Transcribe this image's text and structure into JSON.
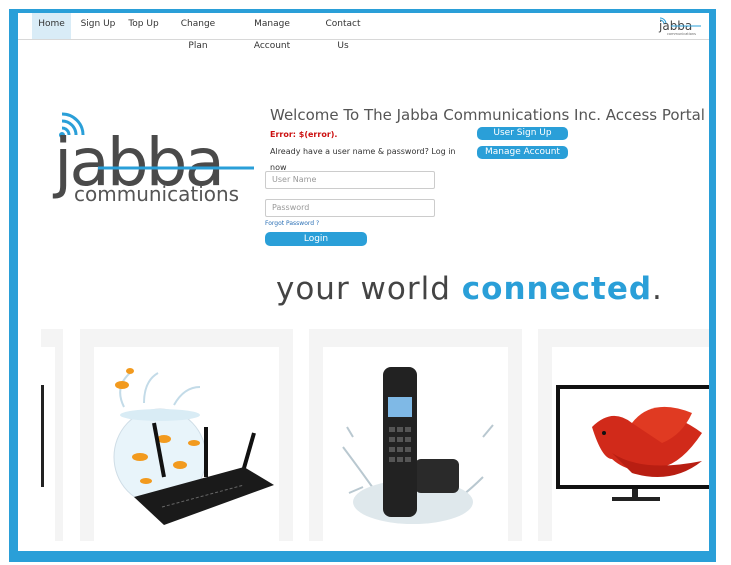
{
  "nav": {
    "items": [
      "Home",
      "Sign Up",
      "Top Up",
      "Change Plan",
      "Manage Account",
      "Contact Us"
    ],
    "active": "Home"
  },
  "brand": {
    "logo_text_top": "jabba",
    "logo_text_bottom": "communications",
    "accent_color": "#2a9fd8"
  },
  "main": {
    "welcome": "Welcome To The Jabba Communications Inc. Access Portal",
    "error": "Error: $(error).",
    "already": "Already have a user name & password? Log in now",
    "user_signup": "User Sign Up",
    "manage_account": "Manage Account",
    "username_placeholder": "User Name",
    "password_placeholder": "Password",
    "forgot": "Forgot Password ?",
    "login": "Login"
  },
  "tagline": {
    "part1": "your world ",
    "part2": "connected",
    "dot": "."
  },
  "cards": [
    {
      "icon": "device-image"
    },
    {
      "icon": "goldfish-router-image"
    },
    {
      "icon": "cordless-phone-splash-image"
    },
    {
      "icon": "tv-betta-fish-image"
    }
  ]
}
